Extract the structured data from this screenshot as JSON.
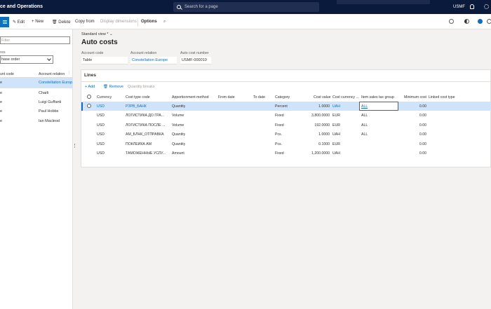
{
  "header": {
    "app_title": "ce and Operations",
    "search_placeholder": "Search for a page",
    "company": "USMF"
  },
  "toolbar": {
    "edit": "Edit",
    "new": "New",
    "delete": "Delete",
    "copy_from": "Copy from",
    "display_dimensions": "Display dimensions",
    "options": "Options"
  },
  "left_panel": {
    "filter_placeholder": "Filter",
    "type_label": "res",
    "type_value": "hase order",
    "col_code": "unt code",
    "col_relation": "Account relation",
    "rows": [
      {
        "code": "e",
        "relation": "Constellation Europ"
      },
      {
        "code": "e",
        "relation": "Charli"
      },
      {
        "code": "e",
        "relation": "Luigi Guffanti"
      },
      {
        "code": "e",
        "relation": "Paul Hobbs"
      },
      {
        "code": "e",
        "relation": "Ian Macleod"
      }
    ]
  },
  "main": {
    "view_label": "Standard view *",
    "title": "Auto costs",
    "fields": {
      "account_code_label": "Account code",
      "account_code_value": "Table",
      "account_relation_label": "Account relation",
      "account_relation_value": "Constellation Europe",
      "auto_cost_number_label": "Auto cost number",
      "auto_cost_number_value": "USMF-000010"
    }
  },
  "lines": {
    "title": "Lines",
    "add": "Add",
    "remove": "Remove",
    "quantity_breaks": "Quantity breaks",
    "columns": [
      "Currency",
      "Cost type code",
      "Apportionment method",
      "From date",
      "To date",
      "Category",
      "Cost value",
      "Cost currency ...",
      "Item sales tax group",
      "Minimum cost",
      "Linked cost type"
    ],
    "rows": [
      {
        "currency": "USD",
        "cost_type": "РЗРВ_БАНК",
        "method": "Quantity",
        "from": "",
        "to": "",
        "category": "Percent",
        "value": "1.0000",
        "cur": "UAH",
        "tax": "ALL",
        "min": "0.00",
        "linked": ""
      },
      {
        "currency": "USD",
        "cost_type": "ЛОГИСТИКА ДО ГРА...",
        "method": "Volume",
        "from": "",
        "to": "",
        "category": "Fixed",
        "value": "3,800.0000",
        "cur": "EUR",
        "tax": "ALL",
        "min": "0.00",
        "linked": ""
      },
      {
        "currency": "USD",
        "cost_type": "ЛОГИСТИКА ПОСЛЕ ...",
        "method": "Volume",
        "from": "",
        "to": "",
        "category": "Fixed",
        "value": "192.0000",
        "cur": "EUR",
        "tax": "ALL",
        "min": "0.00",
        "linked": ""
      },
      {
        "currency": "USD",
        "cost_type": "АМ_БЛНК_ОТПРАВКА",
        "method": "Quantity",
        "from": "",
        "to": "",
        "category": "Pcs.",
        "value": "1.0000",
        "cur": "UAH",
        "tax": "ALL",
        "min": "0.00",
        "linked": ""
      },
      {
        "currency": "USD",
        "cost_type": "ПОКЛЕЙКА АМ",
        "method": "Quantity",
        "from": "",
        "to": "",
        "category": "Pcs.",
        "value": "0.1000",
        "cur": "EUR",
        "tax": "",
        "min": "0.00",
        "linked": ""
      },
      {
        "currency": "USD",
        "cost_type": "ТАМОЖЕННЫЕ УСЛУ...",
        "method": "Amount",
        "from": "",
        "to": "",
        "category": "Fixed",
        "value": "1,200.0000",
        "cur": "UAH",
        "tax": "",
        "min": "0.00",
        "linked": ""
      }
    ]
  },
  "colors": {
    "topbar": "#0a1a3d",
    "accent": "#106ebe",
    "selected_row": "#cfe4fa"
  }
}
